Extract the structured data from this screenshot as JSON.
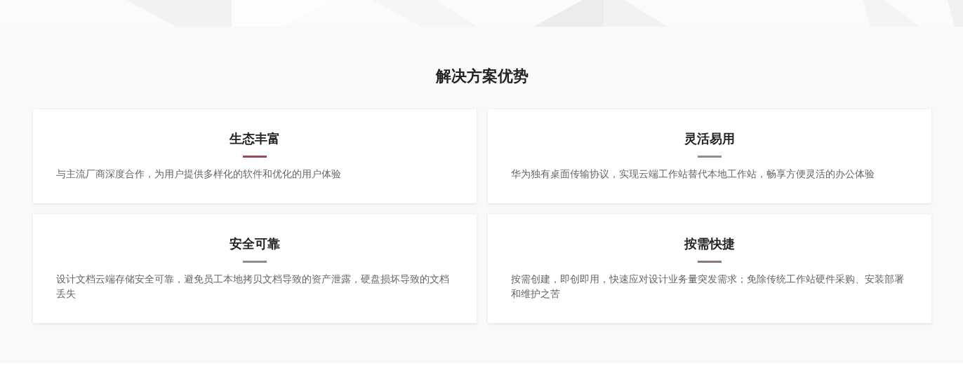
{
  "section": {
    "title": "解决方案优势",
    "cards": [
      {
        "title": "生态丰富",
        "color": "#9b4a55",
        "description": "与主流厂商深度合作，为用户提供多样化的软件和优化的用户体验"
      },
      {
        "title": "灵活易用",
        "color": "#8a8d94",
        "description": "华为独有桌面传输协议，实现云端工作站替代本地工作站，畅享方便灵活的办公体验"
      },
      {
        "title": "安全可靠",
        "color": "#8a8d94",
        "description": "设计文档云端存储安全可靠，避免员工本地拷贝文档导致的资产泄露，硬盘损坏导致的文档丢失"
      },
      {
        "title": "按需快捷",
        "color": "#8c7680",
        "description": "按需创建，即创即用，快速应对设计业务量突发需求；免除传统工作站硬件采购、安装部署和维护之苦"
      }
    ]
  }
}
